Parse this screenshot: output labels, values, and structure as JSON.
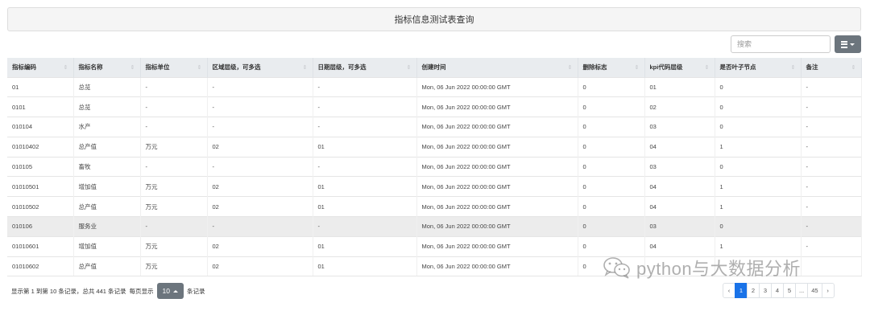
{
  "page": {
    "title": "指标信息测试表查询"
  },
  "toolbar": {
    "search_placeholder": "搜索"
  },
  "table": {
    "columns": [
      "指标编码",
      "指标名称",
      "指标单位",
      "区域层级，可多选",
      "日期层级，可多选",
      "创建时间",
      "删除标志",
      "kpi代码层级",
      "是否叶子节点",
      "备注"
    ],
    "rows": [
      [
        "01",
        "总览",
        "-",
        "-",
        "-",
        "Mon, 06 Jun 2022 00:00:00 GMT",
        "0",
        "01",
        "0",
        "-"
      ],
      [
        "0101",
        "总览",
        "-",
        "-",
        "-",
        "Mon, 06 Jun 2022 00:00:00 GMT",
        "0",
        "02",
        "0",
        "-"
      ],
      [
        "010104",
        "水产",
        "-",
        "-",
        "-",
        "Mon, 06 Jun 2022 00:00:00 GMT",
        "0",
        "03",
        "0",
        "-"
      ],
      [
        "01010402",
        "总产值",
        "万元",
        "02",
        "01",
        "Mon, 06 Jun 2022 00:00:00 GMT",
        "0",
        "04",
        "1",
        "-"
      ],
      [
        "010105",
        "畜牧",
        "-",
        "-",
        "-",
        "Mon, 06 Jun 2022 00:00:00 GMT",
        "0",
        "03",
        "0",
        "-"
      ],
      [
        "01010501",
        "增加值",
        "万元",
        "02",
        "01",
        "Mon, 06 Jun 2022 00:00:00 GMT",
        "0",
        "04",
        "1",
        "-"
      ],
      [
        "01010502",
        "总产值",
        "万元",
        "02",
        "01",
        "Mon, 06 Jun 2022 00:00:00 GMT",
        "0",
        "04",
        "1",
        "-"
      ],
      [
        "010106",
        "服务业",
        "-",
        "-",
        "-",
        "Mon, 06 Jun 2022 00:00:00 GMT",
        "0",
        "03",
        "0",
        "-"
      ],
      [
        "01010601",
        "增加值",
        "万元",
        "02",
        "01",
        "Mon, 06 Jun 2022 00:00:00 GMT",
        "0",
        "04",
        "1",
        "-"
      ],
      [
        "01010602",
        "总产值",
        "万元",
        "02",
        "01",
        "Mon, 06 Jun 2022 00:00:00 GMT",
        "0",
        "",
        "",
        ""
      ]
    ]
  },
  "footer": {
    "summary": "显示第 1 到第 10 条记录，总共 441 条记录",
    "per_page_prefix": "每页显示",
    "page_size": "10",
    "per_page_suffix": "条记录"
  },
  "pagination": {
    "prev": "‹",
    "pages": [
      "1",
      "2",
      "3",
      "4",
      "5",
      "...",
      "45"
    ],
    "next": "›",
    "active": "1"
  },
  "watermark": {
    "text": "python与大数据分析"
  },
  "icons": {
    "view_toggle": "list-icon",
    "sort": "sort-icon",
    "watermark": "wechat-icon"
  },
  "colors": {
    "header_bg": "#e9ecef",
    "button_gray": "#6c757d",
    "active_page": "#1a73e8",
    "highlight_row": "#ececec"
  }
}
